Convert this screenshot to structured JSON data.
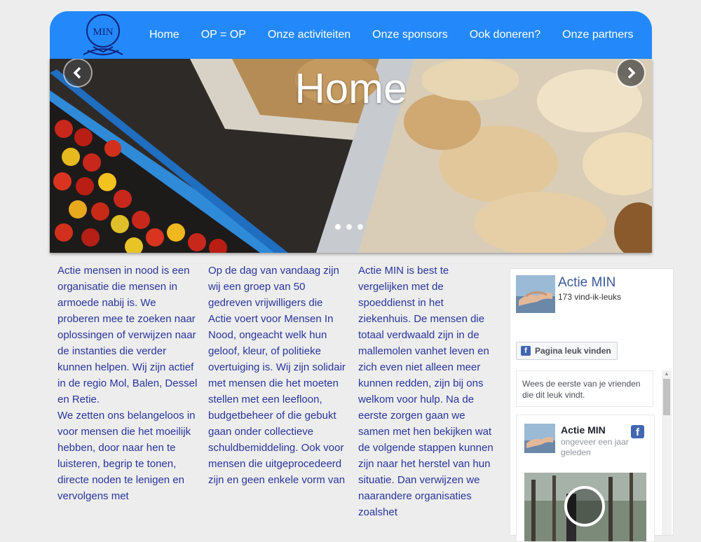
{
  "logo": {
    "text": "MIN"
  },
  "nav": {
    "items": [
      "Home",
      "OP = OP",
      "Onze activiteiten",
      "Onze sponsors",
      "Ook doneren?",
      "Onze partners"
    ]
  },
  "hero": {
    "title": "Home",
    "icons": {
      "prev": "chevron-left-icon",
      "next": "chevron-right-icon"
    },
    "slides": 3,
    "active_slide": 1
  },
  "columns": [
    [
      "Actie mensen in nood is een organisatie die mensen in armoede nabij is. We proberen mee te zoeken naar oplossingen of verwijzen naar de instanties die verder kunnen helpen. Wij zijn actief in de regio Mol, Balen, Dessel en Retie.",
      "We zetten ons belangeloos in voor mensen die het moeilijk hebben, door naar hen te luisteren, begrip te tonen, directe noden te lenigen en vervolgens met"
    ],
    [
      "Op de dag van vandaag zijn wij een groep van 50 gedreven vrijwilligers die Actie voert voor Mensen In Nood, ongeacht welk hun geloof, kleur, of politieke overtuiging is. Wij zijn solidair met mensen die het moeten stellen met een leefloon, budgetbeheer of die gebukt gaan onder collectieve schuldbemiddeling. Ook voor mensen die uitgeprocedeerd zijn en geen enkele vorm van"
    ],
    [
      "Actie MIN is best te vergelijken met de spoeddienst in het ziekenhuis. De mensen die totaal verdwaald zijn in de mallemolen vanhet leven en zich even niet alleen meer kunnen redden, zijn bij ons welkom voor hulp. Na de eerste zorgen gaan we samen met hen bekijken wat de volgende stappen kunnen zijn naar het herstel van hun situatie. Dan verwijzen we naarandere organisaties zoalshet"
    ]
  ],
  "facebook": {
    "page_name": "Actie MIN",
    "likes": "173 vind-ik-leuks",
    "like_button": "Pagina leuk vinden",
    "first_friends": "Wees de eerste van je vrienden die dit leuk vindt.",
    "post": {
      "author": "Actie MIN",
      "time": "ongeveer een jaar geleden"
    },
    "colors": {
      "brand": "#3b5998",
      "button_icon": "#4267b2"
    },
    "icons": {
      "button": "facebook-f-icon",
      "post": "facebook-logo-icon",
      "video": "play-icon"
    }
  },
  "colors": {
    "nav": "#2389fb",
    "text": "#28359a",
    "background": "#ededed"
  }
}
